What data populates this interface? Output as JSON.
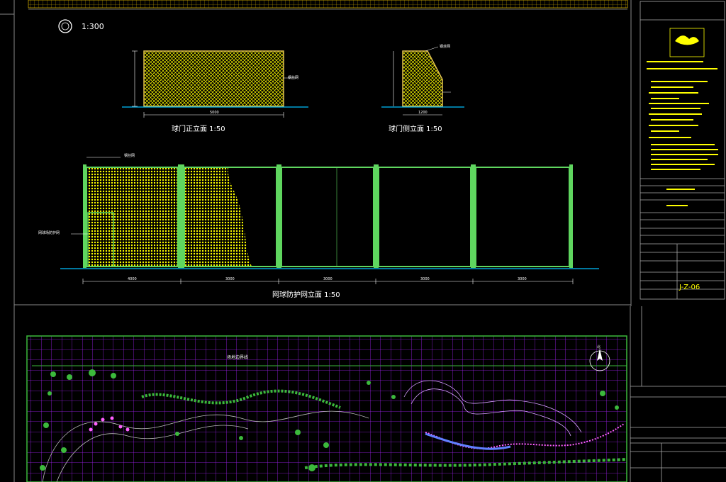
{
  "drawing": {
    "scale_note": "1:300",
    "gate_front_title": "球门正立面 1:50",
    "gate_side_title": "球门侧立面 1:50",
    "fence_title": "网球防护网立面 1:50",
    "gate_front_width_dim": "5000",
    "gate_side_width_dim": "1200",
    "fence_dims": [
      "4000",
      "3000",
      "3000",
      "3000",
      "3000"
    ],
    "gate_front_note": "钢丝网",
    "gate_side_note": "钢丝网",
    "fence_note_top": "钢丝网",
    "fence_note_left": "网球场防护网",
    "sheet_number": "J-Z-06",
    "site_label": "场地边界线",
    "north_label": "北"
  },
  "colors": {
    "yellow": "#ffff00",
    "magenta_grid": "#c000ff",
    "green": "#3cb93c",
    "frame_green": "#5fd65f"
  }
}
